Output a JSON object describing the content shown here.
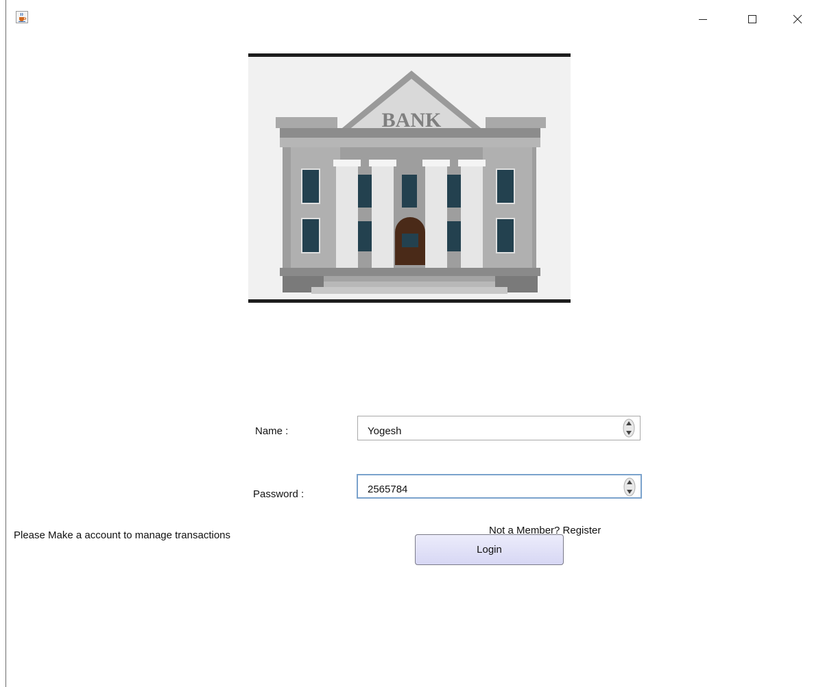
{
  "window": {
    "icon": "java-cup-icon",
    "controls": [
      "minimize-icon",
      "maximize-icon",
      "close-icon"
    ]
  },
  "banner": {
    "sign_text": "BANK"
  },
  "form": {
    "name_label": "Name :",
    "name_value": "Yogesh",
    "password_label": "Password :",
    "password_value": "2565784",
    "login_label": "Login"
  },
  "footer": {
    "info_text": "Please Make a account to manage transactions",
    "register_link": "Not a Member? Register"
  },
  "colors": {
    "button_bg": "#dcdcf6",
    "focus_border": "#7aa2cc"
  }
}
